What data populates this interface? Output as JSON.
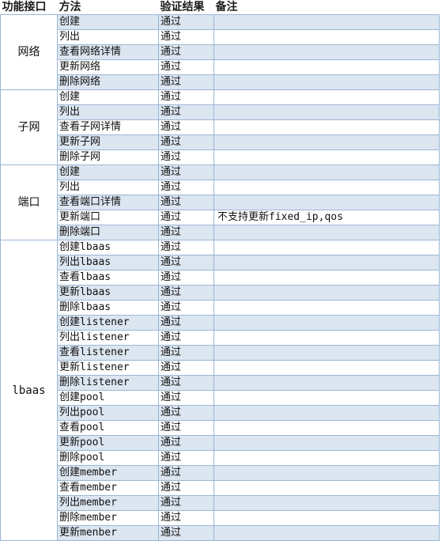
{
  "headers": {
    "iface": "功能接口",
    "method": "方法",
    "result": "验证结果",
    "note": "备注"
  },
  "groups": [
    {
      "name": "网络",
      "rows": [
        {
          "method": "创建",
          "result": "通过",
          "note": ""
        },
        {
          "method": "列出",
          "result": "通过",
          "note": ""
        },
        {
          "method": "查看网络详情",
          "result": "通过",
          "note": ""
        },
        {
          "method": "更新网络",
          "result": "通过",
          "note": ""
        },
        {
          "method": "删除网络",
          "result": "通过",
          "note": ""
        }
      ]
    },
    {
      "name": "子网",
      "rows": [
        {
          "method": "创建",
          "result": "通过",
          "note": ""
        },
        {
          "method": "列出",
          "result": "通过",
          "note": ""
        },
        {
          "method": "查看子网详情",
          "result": "通过",
          "note": ""
        },
        {
          "method": "更新子网",
          "result": "通过",
          "note": ""
        },
        {
          "method": "删除子网",
          "result": "通过",
          "note": ""
        }
      ]
    },
    {
      "name": "端口",
      "rows": [
        {
          "method": "创建",
          "result": "通过",
          "note": ""
        },
        {
          "method": "列出",
          "result": "通过",
          "note": ""
        },
        {
          "method": "查看端口详情",
          "result": "通过",
          "note": ""
        },
        {
          "method": "更新端口",
          "result": "通过",
          "note": "不支持更新fixed_ip,qos"
        },
        {
          "method": "删除端口",
          "result": "通过",
          "note": ""
        }
      ]
    },
    {
      "name": "lbaas",
      "rows": [
        {
          "method": "创建lbaas",
          "result": "通过",
          "note": ""
        },
        {
          "method": "列出lbaas",
          "result": "通过",
          "note": ""
        },
        {
          "method": "查看lbaas",
          "result": "通过",
          "note": ""
        },
        {
          "method": "更新lbaas",
          "result": "通过",
          "note": ""
        },
        {
          "method": "删除lbaas",
          "result": "通过",
          "note": ""
        },
        {
          "method": "创建listener",
          "result": "通过",
          "note": ""
        },
        {
          "method": "列出listener",
          "result": "通过",
          "note": ""
        },
        {
          "method": "查看listener",
          "result": "通过",
          "note": ""
        },
        {
          "method": "更新listener",
          "result": "通过",
          "note": ""
        },
        {
          "method": "删除listener",
          "result": "通过",
          "note": ""
        },
        {
          "method": "创建pool",
          "result": "通过",
          "note": ""
        },
        {
          "method": "列出pool",
          "result": "通过",
          "note": ""
        },
        {
          "method": "查看pool",
          "result": "通过",
          "note": ""
        },
        {
          "method": "更新pool",
          "result": "通过",
          "note": ""
        },
        {
          "method": "删除pool",
          "result": "通过",
          "note": ""
        },
        {
          "method": "创建member",
          "result": "通过",
          "note": ""
        },
        {
          "method": "查看member",
          "result": "通过",
          "note": ""
        },
        {
          "method": "列出member",
          "result": "通过",
          "note": ""
        },
        {
          "method": "删除member",
          "result": "通过",
          "note": ""
        },
        {
          "method": "更新menber",
          "result": "通过",
          "note": ""
        }
      ]
    }
  ],
  "colors": {
    "band": "#dce6f1",
    "border": "#9bb7d4"
  }
}
